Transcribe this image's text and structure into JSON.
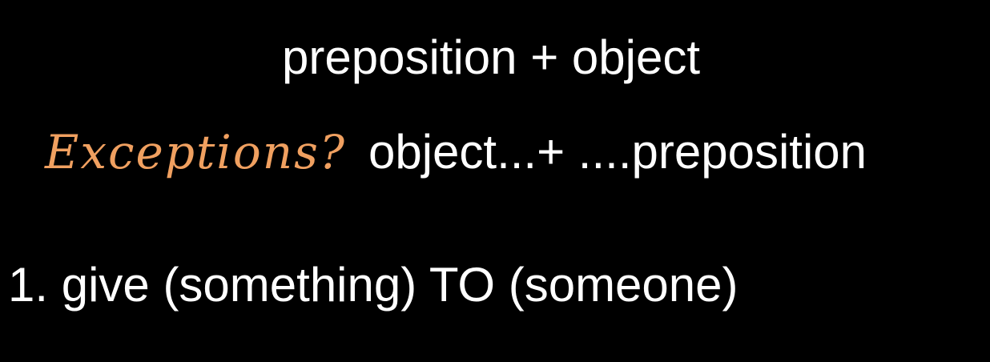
{
  "slide": {
    "title": "preposition + object",
    "exceptions_label": "Exceptions?",
    "exceptions_pattern": "object...+ ....preposition",
    "list_item_1": "1. give (something) TO (someone)"
  },
  "colors": {
    "background": "#000000",
    "text": "#ffffff",
    "accent": "#f0a060"
  }
}
